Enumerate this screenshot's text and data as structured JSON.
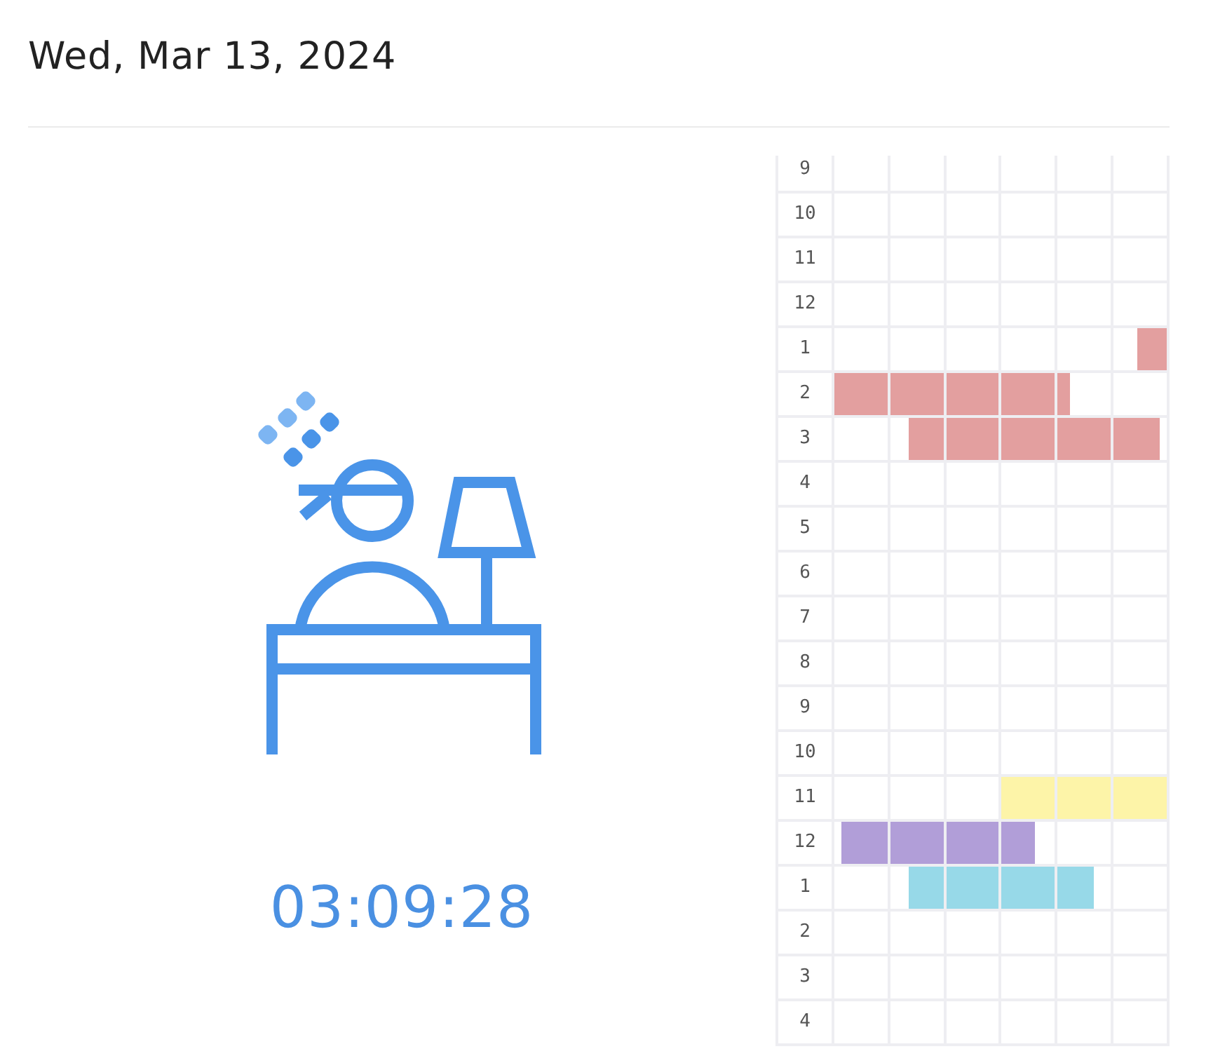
{
  "date_heading": "Wed, Mar 13, 2024",
  "elapsed_time": "03:09:28",
  "timeline": {
    "rows": [
      {
        "label": "9",
        "cells": [
          {
            "filled": false
          },
          {
            "filled": false
          },
          {
            "filled": false
          },
          {
            "filled": false
          },
          {
            "filled": false
          },
          {
            "filled": false
          }
        ]
      },
      {
        "label": "10",
        "cells": [
          {
            "filled": false
          },
          {
            "filled": false
          },
          {
            "filled": false
          },
          {
            "filled": false
          },
          {
            "filled": false
          },
          {
            "filled": false
          }
        ]
      },
      {
        "label": "11",
        "cells": [
          {
            "filled": false
          },
          {
            "filled": false
          },
          {
            "filled": false
          },
          {
            "filled": false
          },
          {
            "filled": false
          },
          {
            "filled": false
          }
        ]
      },
      {
        "label": "12",
        "cells": [
          {
            "filled": false
          },
          {
            "filled": false
          },
          {
            "filled": false
          },
          {
            "filled": false
          },
          {
            "filled": false
          },
          {
            "filled": false
          }
        ]
      },
      {
        "label": "1",
        "cells": [
          {
            "filled": false
          },
          {
            "filled": false
          },
          {
            "filled": false
          },
          {
            "filled": false
          },
          {
            "filled": false
          },
          {
            "filled": true,
            "level": 0.55,
            "kind": "end",
            "color": "#e39f9f"
          }
        ]
      },
      {
        "label": "2",
        "cells": [
          {
            "filled": true,
            "level": 1,
            "color": "#e39f9f"
          },
          {
            "filled": true,
            "level": 1,
            "color": "#e39f9f"
          },
          {
            "filled": true,
            "level": 1,
            "color": "#e39f9f"
          },
          {
            "filled": true,
            "level": 1,
            "color": "#e39f9f"
          },
          {
            "filled": true,
            "level": 0.23,
            "kind": "start",
            "color": "#e39f9f"
          },
          {
            "filled": false
          }
        ]
      },
      {
        "label": "3",
        "cells": [
          {
            "filled": false
          },
          {
            "filled": true,
            "level": 0.65,
            "kind": "end",
            "color": "#e39f9f"
          },
          {
            "filled": true,
            "level": 1,
            "color": "#e39f9f"
          },
          {
            "filled": true,
            "level": 1,
            "color": "#e39f9f"
          },
          {
            "filled": true,
            "level": 1,
            "color": "#e39f9f"
          },
          {
            "filled": true,
            "level": 0.87,
            "kind": "start",
            "color": "#e39f9f"
          }
        ]
      },
      {
        "label": "4",
        "cells": [
          {
            "filled": false
          },
          {
            "filled": false
          },
          {
            "filled": false
          },
          {
            "filled": false
          },
          {
            "filled": false
          },
          {
            "filled": false
          }
        ]
      },
      {
        "label": "5",
        "cells": [
          {
            "filled": false
          },
          {
            "filled": false
          },
          {
            "filled": false
          },
          {
            "filled": false
          },
          {
            "filled": false
          },
          {
            "filled": false
          }
        ]
      },
      {
        "label": "6",
        "cells": [
          {
            "filled": false
          },
          {
            "filled": false
          },
          {
            "filled": false
          },
          {
            "filled": false
          },
          {
            "filled": false
          },
          {
            "filled": false
          }
        ]
      },
      {
        "label": "7",
        "cells": [
          {
            "filled": false
          },
          {
            "filled": false
          },
          {
            "filled": false
          },
          {
            "filled": false
          },
          {
            "filled": false
          },
          {
            "filled": false
          }
        ]
      },
      {
        "label": "8",
        "cells": [
          {
            "filled": false
          },
          {
            "filled": false
          },
          {
            "filled": false
          },
          {
            "filled": false
          },
          {
            "filled": false
          },
          {
            "filled": false
          }
        ]
      },
      {
        "label": "9",
        "cells": [
          {
            "filled": false
          },
          {
            "filled": false
          },
          {
            "filled": false
          },
          {
            "filled": false
          },
          {
            "filled": false
          },
          {
            "filled": false
          }
        ]
      },
      {
        "label": "10",
        "cells": [
          {
            "filled": false
          },
          {
            "filled": false
          },
          {
            "filled": false
          },
          {
            "filled": false
          },
          {
            "filled": false
          },
          {
            "filled": false
          }
        ]
      },
      {
        "label": "11",
        "cells": [
          {
            "filled": false
          },
          {
            "filled": false
          },
          {
            "filled": false
          },
          {
            "filled": true,
            "level": 1,
            "color": "#fdf4a8"
          },
          {
            "filled": true,
            "level": 1,
            "color": "#fdf4a8"
          },
          {
            "filled": true,
            "level": 1,
            "color": "#fdf4a8"
          }
        ]
      },
      {
        "label": "12",
        "cells": [
          {
            "filled": true,
            "level": 0.88,
            "kind": "end",
            "color": "#b19ed8"
          },
          {
            "filled": true,
            "level": 1,
            "color": "#b19ed8"
          },
          {
            "filled": true,
            "level": 1,
            "color": "#b19ed8"
          },
          {
            "filled": true,
            "level": 0.62,
            "kind": "start",
            "color": "#b19ed8"
          },
          {
            "filled": false
          },
          {
            "filled": false
          }
        ]
      },
      {
        "label": "1",
        "cells": [
          {
            "filled": false
          },
          {
            "filled": true,
            "level": 0.65,
            "kind": "end",
            "color": "#97d9e8"
          },
          {
            "filled": true,
            "level": 1,
            "color": "#97d9e8"
          },
          {
            "filled": true,
            "level": 1,
            "color": "#97d9e8"
          },
          {
            "filled": true,
            "level": 0.68,
            "kind": "start",
            "color": "#97d9e8"
          },
          {
            "filled": false
          }
        ]
      },
      {
        "label": "2",
        "cells": [
          {
            "filled": false
          },
          {
            "filled": false
          },
          {
            "filled": false
          },
          {
            "filled": false
          },
          {
            "filled": false
          },
          {
            "filled": false
          }
        ]
      },
      {
        "label": "3",
        "cells": [
          {
            "filled": false
          },
          {
            "filled": false
          },
          {
            "filled": false
          },
          {
            "filled": false
          },
          {
            "filled": false
          },
          {
            "filled": false
          }
        ]
      },
      {
        "label": "4",
        "cells": [
          {
            "filled": false
          },
          {
            "filled": false
          },
          {
            "filled": false
          },
          {
            "filled": false
          },
          {
            "filled": false
          },
          {
            "filled": false
          }
        ]
      }
    ]
  }
}
